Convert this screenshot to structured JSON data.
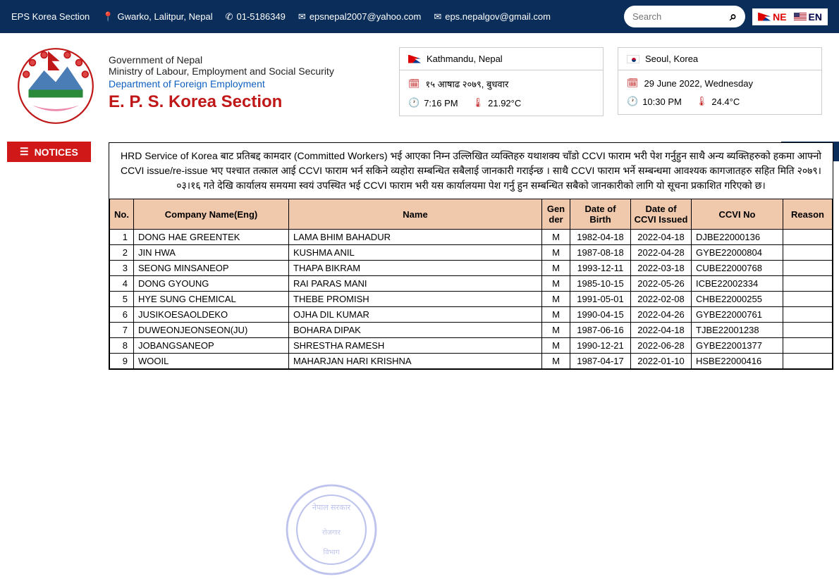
{
  "topbar": {
    "site": "EPS Korea Section",
    "location": "Gwarko, Lalitpur, Nepal",
    "phone": "01-5186349",
    "email1": "epsnepal2007@yahoo.com",
    "email2": "eps.nepalgov@gmail.com",
    "search_placeholder": "Search",
    "lang_ne": "NE",
    "lang_en": "EN"
  },
  "header": {
    "gov": "Government of Nepal",
    "ministry": "Ministry of Labour, Employment and Social Security",
    "dept": "Department of Foreign Employment",
    "title": "E. P. S. Korea Section"
  },
  "loc1": {
    "city": "Kathmandu, Nepal",
    "date": "१५ आषाढ २०७९, बुधवार",
    "time": "7:16 PM",
    "temp": "21.92°C"
  },
  "loc2": {
    "city": "Seoul, Korea",
    "date": "29 June 2022, Wednesday",
    "time": "10:30 PM",
    "temp": "24.4°C"
  },
  "notices_label": "NOTICES",
  "notice_body": "HRD Service of Korea बाट प्रतिबद्द कामदार (Committed Workers) भई आएका निम्न उल्लिखित व्यक्तिहरु यथाशक्य चाँडो CCVI फाराम भरी पेश गर्नुहुन साथै अन्य ब्यक्तिहरुको हकमा आफ्नो CCVI issue/re-issue भए पश्चात तत्काल आई CCVI फाराम भर्न सकिने व्यहोरा सम्बन्धित सबैलाई जानकारी गराईन्छ । साथै CCVI फाराम भर्ने सम्बन्धमा आवश्यक कागजातहरु सहित मिति २०७९।०३।१६ गते देखि कार्यालय समयमा स्वयं उपस्थित भई CCVI फाराम भरी यस कार्यालयमा पेश गर्नु हुन सम्बन्धित सबैको जानकारीको लागि यो सूचना प्रकाशित गरिएको छ।",
  "table": {
    "headers": [
      "No.",
      "Company Name(Eng)",
      "Name",
      "Gen der",
      "Date of Birth",
      "Date of CCVI Issued",
      "CCVI No",
      "Reason"
    ],
    "rows": [
      {
        "no": "1",
        "company": "DONG HAE GREENTEK",
        "name": "LAMA BHIM BAHADUR",
        "gender": "M",
        "dob": "1982-04-18",
        "ccvi_date": "2022-04-18",
        "ccvi_no": "DJBE22000136",
        "reason": ""
      },
      {
        "no": "2",
        "company": "JIN HWA",
        "name": "KUSHMA ANIL",
        "gender": "M",
        "dob": "1987-08-18",
        "ccvi_date": "2022-04-28",
        "ccvi_no": "GYBE22000804",
        "reason": ""
      },
      {
        "no": "3",
        "company": "SEONG MINSANEOP",
        "name": "THAPA BIKRAM",
        "gender": "M",
        "dob": "1993-12-11",
        "ccvi_date": "2022-03-18",
        "ccvi_no": "CUBE22000768",
        "reason": ""
      },
      {
        "no": "4",
        "company": "DONG GYOUNG",
        "name": "RAI PARAS MANI",
        "gender": "M",
        "dob": "1985-10-15",
        "ccvi_date": "2022-05-26",
        "ccvi_no": "ICBE22002334",
        "reason": ""
      },
      {
        "no": "5",
        "company": "HYE SUNG CHEMICAL",
        "name": "THEBE PROMISH",
        "gender": "M",
        "dob": "1991-05-01",
        "ccvi_date": "2022-02-08",
        "ccvi_no": "CHBE22000255",
        "reason": ""
      },
      {
        "no": "6",
        "company": "JUSIKOESAOLDEKO",
        "name": "OJHA DIL KUMAR",
        "gender": "M",
        "dob": "1990-04-15",
        "ccvi_date": "2022-04-26",
        "ccvi_no": "GYBE22000761",
        "reason": ""
      },
      {
        "no": "7",
        "company": "DUWEONJEONSEON(JU)",
        "name": "BOHARA DIPAK",
        "gender": "M",
        "dob": "1987-06-16",
        "ccvi_date": "2022-04-18",
        "ccvi_no": "TJBE22001238",
        "reason": ""
      },
      {
        "no": "8",
        "company": "JOBANGSANEOP",
        "name": "SHRESTHA RAMESH",
        "gender": "M",
        "dob": "1990-12-21",
        "ccvi_date": "2022-06-28",
        "ccvi_no": "GYBE22001377",
        "reason": ""
      },
      {
        "no": "9",
        "company": "WOOIL",
        "name": "MAHARJAN HARI KRISHNA",
        "gender": "M",
        "dob": "1987-04-17",
        "ccvi_date": "2022-01-10",
        "ccvi_no": "HSBE22000416",
        "reason": ""
      }
    ]
  }
}
